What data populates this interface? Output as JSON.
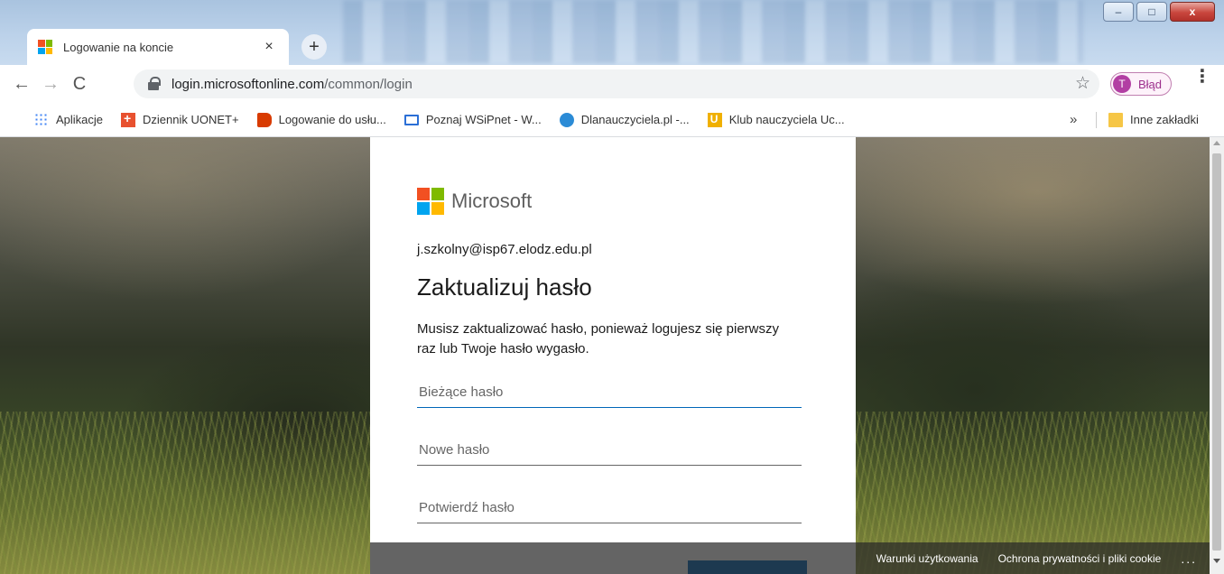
{
  "window": {
    "minimize_label": "–",
    "maximize_label": "□",
    "close_label": "x"
  },
  "tab": {
    "title": "Logowanie na koncie",
    "close_label": "×",
    "new_tab_label": "+"
  },
  "toolbar": {
    "back_label": "←",
    "forward_label": "→",
    "reload_label": "C",
    "url_host": "login.microsoftonline.com",
    "url_path": "/common/login",
    "star_label": "☆",
    "profile_initial": "T",
    "profile_label": "Błąd",
    "menu_label": "⋮"
  },
  "bookmarks": {
    "items": [
      {
        "label": "Aplikacje",
        "icon": "apps-icon"
      },
      {
        "label": "Dziennik UONET+",
        "icon": "uonet-icon"
      },
      {
        "label": "Logowanie do usłu...",
        "icon": "office-icon"
      },
      {
        "label": "Poznaj WSiPnet - W...",
        "icon": "wsip-icon"
      },
      {
        "label": "Dlanauczyciela.pl -...",
        "icon": "globe-icon"
      },
      {
        "label": "Klub nauczyciela Uc...",
        "icon": "klub-icon"
      }
    ],
    "more_label": "»",
    "other_label": "Inne zakładki"
  },
  "card": {
    "brand": "Microsoft",
    "identity": "j.szkolny@isp67.elodz.edu.pl",
    "heading": "Zaktualizuj hasło",
    "description": "Musisz zaktualizować hasło, ponieważ logujesz się pierwszy raz lub Twoje hasło wygasło.",
    "current_password_placeholder": "Bieżące hasło",
    "new_password_placeholder": "Nowe hasło",
    "confirm_password_placeholder": "Potwierdź hasło"
  },
  "footer": {
    "terms_label": "Warunki użytkowania",
    "privacy_label": "Ochrona prywatności i pliki cookie",
    "more_label": "..."
  },
  "colors": {
    "accent": "#0067b8",
    "profile": "#b23fa3"
  }
}
